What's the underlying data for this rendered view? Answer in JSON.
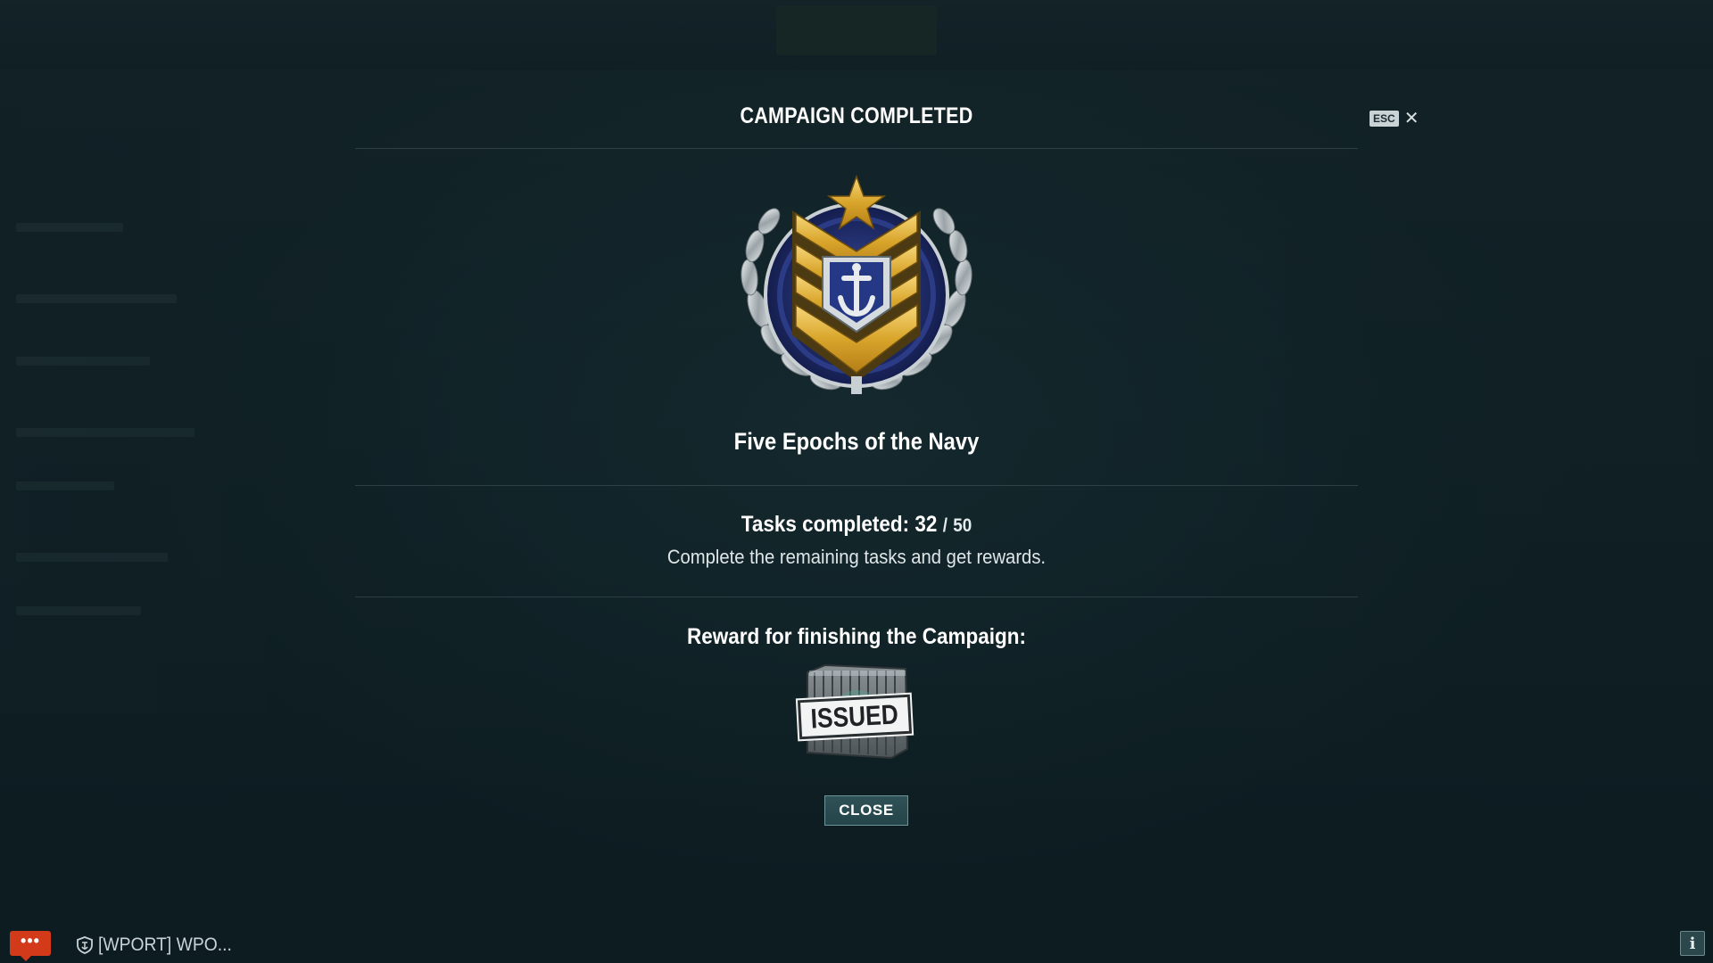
{
  "dialog": {
    "title": "CAMPAIGN COMPLETED",
    "esc_label": "ESC",
    "close_glyph": "✕",
    "campaign_name": "Five Epochs of the Navy",
    "tasks_label": "Tasks completed:",
    "tasks_done": "32",
    "tasks_separator": "/",
    "tasks_total": "50",
    "tasks_hint": "Complete the remaining tasks and get rewards.",
    "reward_title": "Reward for finishing the Campaign:",
    "reward_status": "ISSUED",
    "close_button": "CLOSE"
  },
  "bottom_bar": {
    "chat_glyph": "•••",
    "clan_channel": "[WPORT] WPO...",
    "info_glyph": "i"
  },
  "icons": {
    "medal": "campaign-medal-icon",
    "crate": "reward-container-icon",
    "chat": "chat-bubble-icon",
    "clan": "clan-shield-icon",
    "info": "info-icon"
  },
  "colors": {
    "chat_button": "#d33a1a",
    "close_button": "#2f5257",
    "medal_gold": "#e0b13a",
    "medal_blue": "#1f2c6e"
  }
}
